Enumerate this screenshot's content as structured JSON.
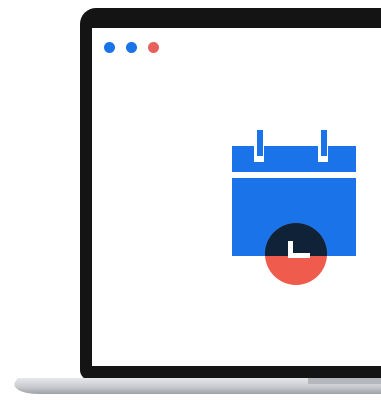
{
  "window_controls": {
    "dots": [
      {
        "color": "#1a73e8"
      },
      {
        "color": "#1a73e8"
      },
      {
        "color": "#e8605a"
      }
    ]
  },
  "illustration": {
    "icon": "calendar-clock-icon",
    "colors": {
      "calendar": "#1a73e8",
      "clock_face": "#0f2238",
      "clock_bottom": "#ef5b4c",
      "hands": "#ffffff"
    }
  },
  "device": {
    "icon": "laptop-icon",
    "colors": {
      "bezel": "#141414",
      "screen": "#ffffff",
      "base": "#c9cbcf"
    }
  }
}
